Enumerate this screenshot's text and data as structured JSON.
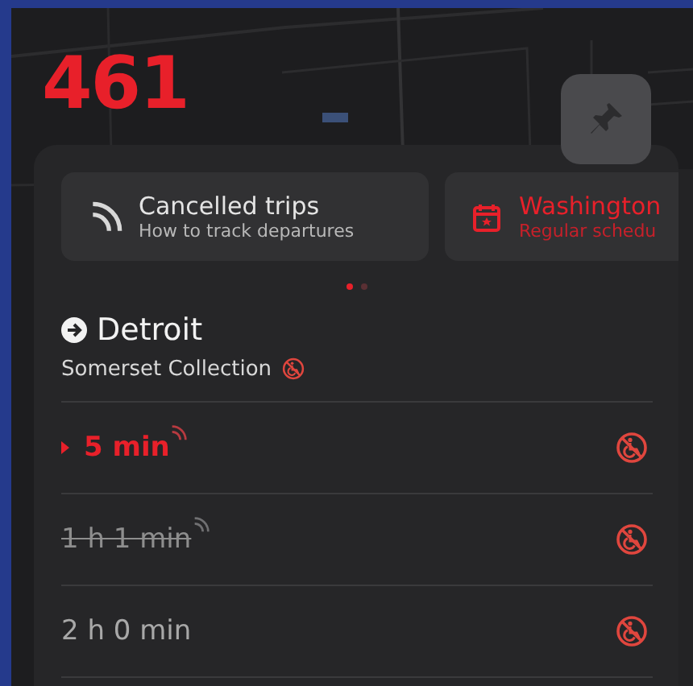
{
  "route": "461",
  "alerts": [
    {
      "kind": "cancelled",
      "title": "Cancelled trips",
      "subtitle": "How to track departures"
    },
    {
      "kind": "schedule",
      "title": "Washington",
      "subtitle": "Regular schedu"
    }
  ],
  "pages": [
    {
      "selected": true
    },
    {
      "selected": false
    }
  ],
  "direction": {
    "destination": "Detroit",
    "stop": "Somerset Collection",
    "accessible": false
  },
  "departures": [
    {
      "time": "5 min",
      "upcoming": true,
      "realtime": true,
      "cancelled": false,
      "accessible": false
    },
    {
      "time": "1 h 1 min",
      "upcoming": false,
      "realtime": true,
      "cancelled": true,
      "accessible": false
    },
    {
      "time": "2 h 0 min",
      "upcoming": false,
      "realtime": false,
      "cancelled": false,
      "accessible": false
    }
  ]
}
